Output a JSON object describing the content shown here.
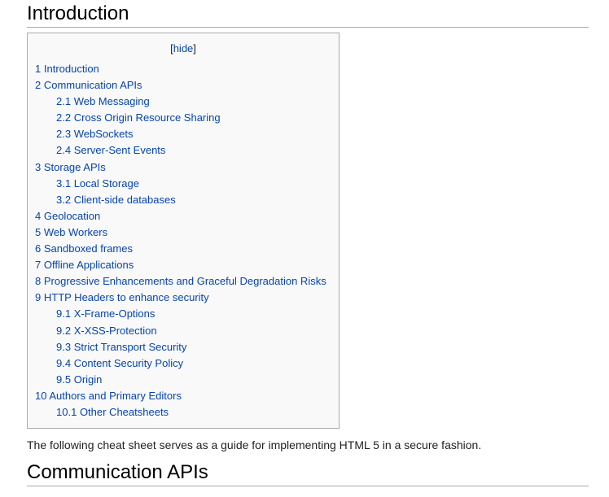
{
  "headings": {
    "introduction": "Introduction",
    "communication_apis": "Communication APIs"
  },
  "toc": {
    "hide_open": "[",
    "hide_label": "hide",
    "hide_close": "]",
    "items": [
      {
        "num": "1",
        "label": "Introduction",
        "level": 1
      },
      {
        "num": "2",
        "label": "Communication APIs",
        "level": 1
      },
      {
        "num": "2.1",
        "label": "Web Messaging",
        "level": 2
      },
      {
        "num": "2.2",
        "label": "Cross Origin Resource Sharing",
        "level": 2
      },
      {
        "num": "2.3",
        "label": "WebSockets",
        "level": 2
      },
      {
        "num": "2.4",
        "label": "Server-Sent Events",
        "level": 2
      },
      {
        "num": "3",
        "label": "Storage APIs",
        "level": 1
      },
      {
        "num": "3.1",
        "label": "Local Storage",
        "level": 2
      },
      {
        "num": "3.2",
        "label": "Client-side databases",
        "level": 2
      },
      {
        "num": "4",
        "label": "Geolocation",
        "level": 1
      },
      {
        "num": "5",
        "label": "Web Workers",
        "level": 1
      },
      {
        "num": "6",
        "label": "Sandboxed frames",
        "level": 1
      },
      {
        "num": "7",
        "label": "Offline Applications",
        "level": 1
      },
      {
        "num": "8",
        "label": "Progressive Enhancements and Graceful Degradation Risks",
        "level": 1
      },
      {
        "num": "9",
        "label": "HTTP Headers to enhance security",
        "level": 1
      },
      {
        "num": "9.1",
        "label": "X-Frame-Options",
        "level": 2
      },
      {
        "num": "9.2",
        "label": "X-XSS-Protection",
        "level": 2
      },
      {
        "num": "9.3",
        "label": "Strict Transport Security",
        "level": 2
      },
      {
        "num": "9.4",
        "label": "Content Security Policy",
        "level": 2
      },
      {
        "num": "9.5",
        "label": "Origin",
        "level": 2
      },
      {
        "num": "10",
        "label": "Authors and Primary Editors",
        "level": 1
      },
      {
        "num": "10.1",
        "label": "Other Cheatsheets",
        "level": 2
      }
    ]
  },
  "intro_paragraph": "The following cheat sheet serves as a guide for implementing HTML 5 in a secure fashion.",
  "colors": {
    "link": "#0645ad",
    "toc_background": "#f9f9f9",
    "toc_border": "#aaaaaa",
    "text": "#222222"
  }
}
